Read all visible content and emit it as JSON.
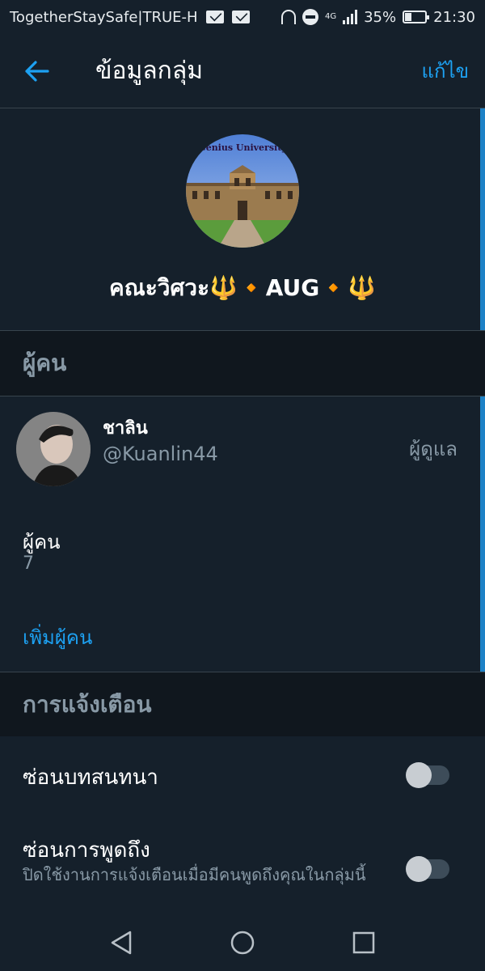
{
  "status_bar": {
    "carrier": "TogetherStaySafe|TRUE-H",
    "network": "4G",
    "battery": "35%",
    "battery_level": 0.35,
    "time": "21:30"
  },
  "app_bar": {
    "title": "ข้อมูลกลุ่ม",
    "edit_label": "แก้ไข"
  },
  "group": {
    "name": "คณะวิศวะ🔱🔸AUG🔸🔱",
    "avatar_text": "Genius University"
  },
  "people_section": {
    "title": "ผู้คน",
    "members": [
      {
        "name": "ชาลิน",
        "handle": "@Kuanlin44",
        "role": "ผู้ดูแล"
      }
    ],
    "count_label": "ผู้คน",
    "count_value": "7",
    "add_label": "เพิ่มผู้คน"
  },
  "notifications_section": {
    "title": "การแจ้งเตือน",
    "settings": [
      {
        "label": "ซ่อนบทสนทนา",
        "enabled": false
      },
      {
        "label": "ซ่อนการพูดถึง",
        "description": "ปิดใช้งานการแจ้งเตือนเมื่อมีคนพูดถึงคุณในกลุ่มนี้",
        "enabled": false
      }
    ]
  },
  "colors": {
    "background": "#15202b",
    "section_background": "#10171e",
    "accent": "#1da1f2",
    "secondary_text": "#8899a6"
  },
  "icons": {
    "back": "arrow-left-icon",
    "nav_back": "triangle-back-icon",
    "nav_home": "circle-home-icon",
    "nav_recents": "square-recents-icon"
  }
}
